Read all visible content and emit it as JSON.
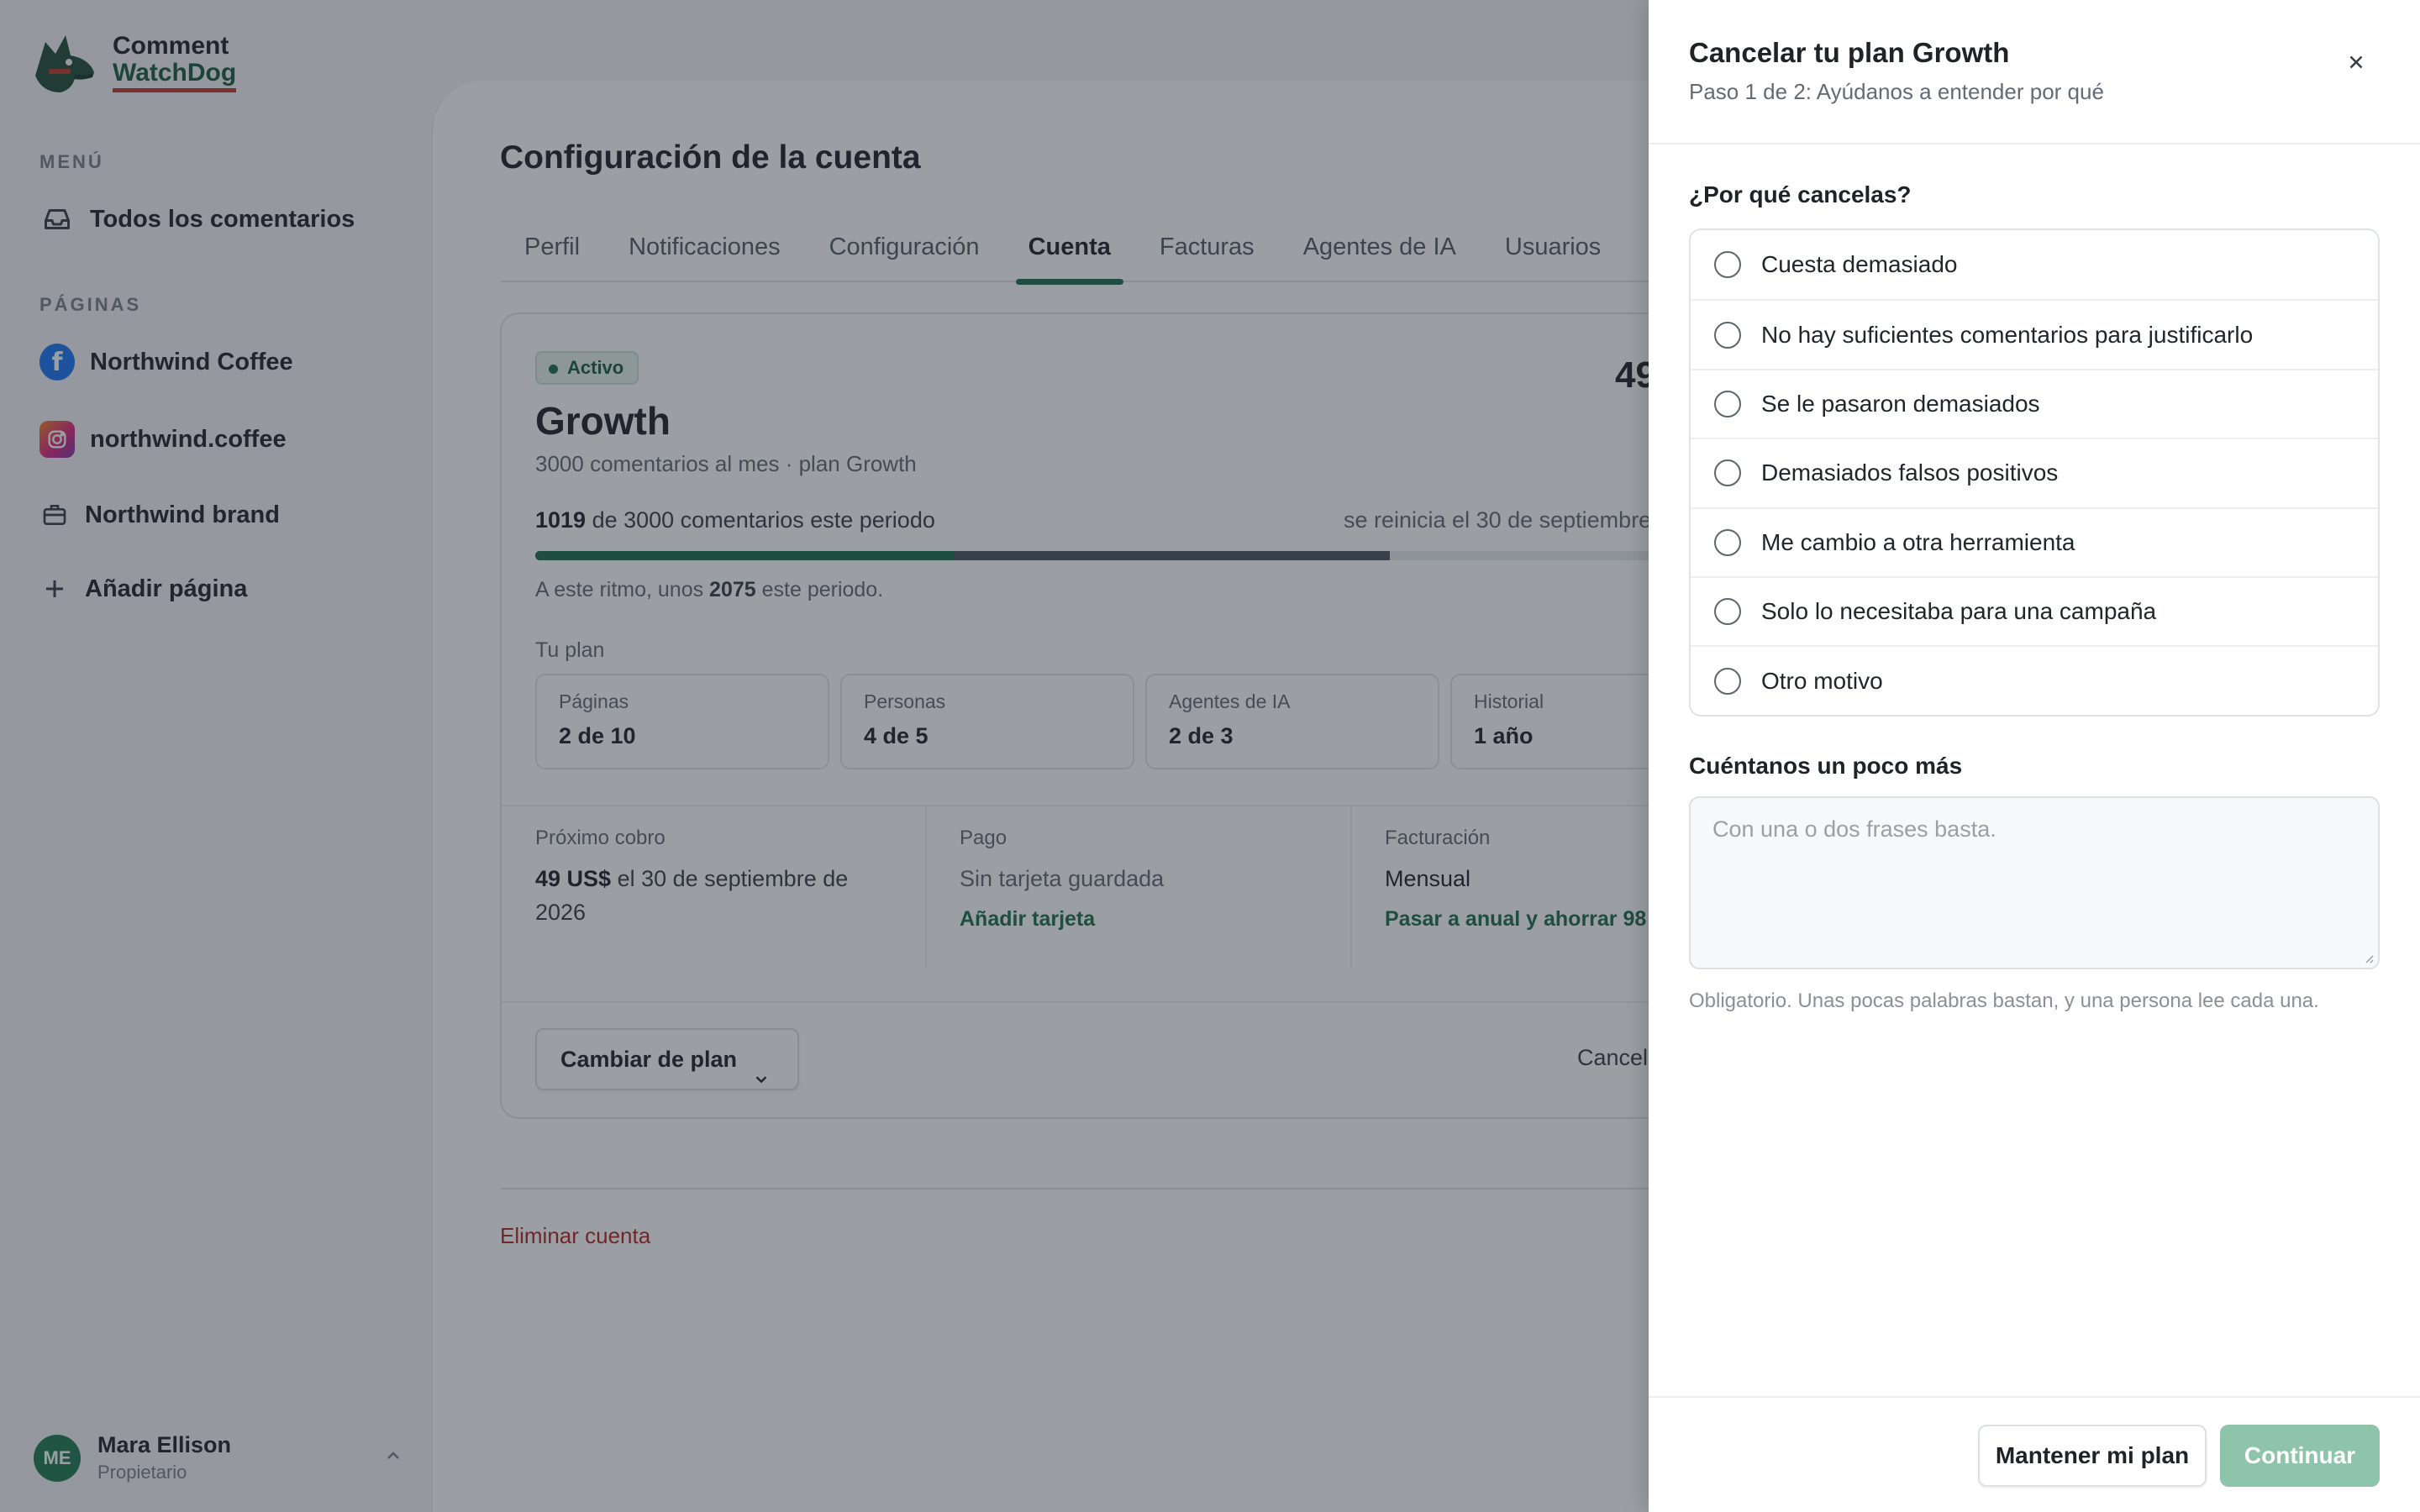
{
  "app": {
    "name_line1": "Comment",
    "name_line2": "WatchDog"
  },
  "sidebar": {
    "menu_label": "MENÚ",
    "all_comments": "Todos los comentarios",
    "pages_label": "PÁGINAS",
    "pages": [
      {
        "label": "Northwind Coffee",
        "icon": "facebook-icon"
      },
      {
        "label": "northwind.coffee",
        "icon": "instagram-icon"
      },
      {
        "label": "Northwind brand",
        "icon": "briefcase-icon"
      }
    ],
    "add_page": "Añadir página"
  },
  "user": {
    "initials": "ME",
    "name": "Mara Ellison",
    "role": "Propietario"
  },
  "main": {
    "title": "Configuración de la cuenta",
    "tabs": [
      "Perfil",
      "Notificaciones",
      "Configuración",
      "Cuenta",
      "Facturas",
      "Agentes de IA",
      "Usuarios"
    ],
    "active_tab": "Cuenta"
  },
  "plan": {
    "status": "Activo",
    "price_fragment": "49",
    "name": "Growth",
    "subtitle": "3000 comentarios al mes · plan Growth",
    "used": "1019",
    "usage_rest": " de 3000 comentarios este periodo",
    "reset": "se reinicia el 30 de septiembre",
    "progress_fraction": 0.3397,
    "projected_fraction": 0.6917,
    "pace_prefix": "A este ritmo, unos ",
    "pace_value": "2075",
    "pace_suffix": " este periodo.",
    "your_plan_label": "Tu plan",
    "stats": [
      {
        "k": "Páginas",
        "v": "2 de 10"
      },
      {
        "k": "Personas",
        "v": "4 de 5"
      },
      {
        "k": "Agentes de IA",
        "v": "2 de 3"
      },
      {
        "k": "Historial",
        "v": "1 año"
      }
    ],
    "next_charge_label": "Próximo cobro",
    "next_charge_amount": "49 US$",
    "next_charge_rest": " el 30 de septiembre de 2026",
    "payment_label": "Pago",
    "payment_value": "Sin tarjeta guardada",
    "payment_link": "Añadir tarjeta",
    "billing_label": "Facturación",
    "billing_value": "Mensual",
    "billing_link": "Pasar a anual y ahorrar 98",
    "change_plan": "Cambiar de plan",
    "cancel_fragment": "Cancel",
    "delete_account": "Eliminar cuenta"
  },
  "drawer": {
    "title": "Cancelar tu plan Growth",
    "subtitle": "Paso 1 de 2: Ayúdanos a entender por qué",
    "question": "¿Por qué cancelas?",
    "options": [
      "Cuesta demasiado",
      "No hay suficientes comentarios para justificarlo",
      "Se le pasaron demasiados",
      "Demasiados falsos positivos",
      "Me cambio a otra herramienta",
      "Solo lo necesitaba para una campaña",
      "Otro motivo"
    ],
    "more_label": "Cuéntanos un poco más",
    "textarea_placeholder": "Con una o dos frases basta.",
    "hint": "Obligatorio. Unas pocas palabras bastan, y una persona lee cada una.",
    "keep_button": "Mantener mi plan",
    "continue_button": "Continuar"
  },
  "colors": {
    "accent": "#1b6e49",
    "danger": "#b3261e",
    "continue_disabled": "#8ec4a9"
  }
}
